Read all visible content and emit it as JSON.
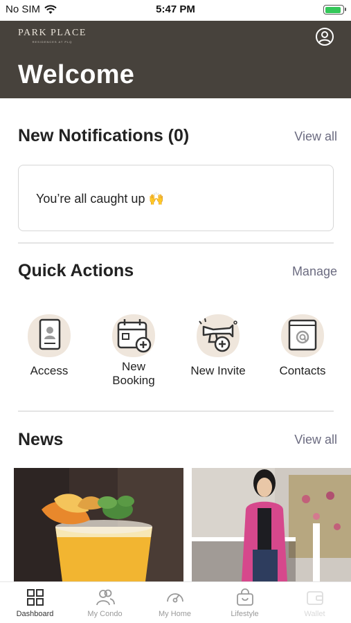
{
  "status_bar": {
    "carrier": "No SIM",
    "time": "5:47 PM"
  },
  "header": {
    "logo_main": "PARK PLACE",
    "logo_sub": "RESIDENCES AT PLQ",
    "title": "Welcome"
  },
  "notifications": {
    "title": "New Notifications (0)",
    "view_all": "View all",
    "empty_message": "You’re all caught up 🙌"
  },
  "quick_actions": {
    "title": "Quick Actions",
    "manage": "Manage",
    "items": [
      {
        "label": "Access",
        "icon": "id-badge-icon"
      },
      {
        "label": "New\nBooking",
        "icon": "calendar-plus-icon"
      },
      {
        "label": "New Invite",
        "icon": "trumpet-plus-icon"
      },
      {
        "label": "Contacts",
        "icon": "contact-book-icon"
      }
    ]
  },
  "news": {
    "title": "News",
    "view_all": "View all"
  },
  "tab_bar": {
    "items": [
      {
        "label": "Dashboard",
        "icon": "dashboard-grid-icon",
        "active": true
      },
      {
        "label": "My Condo",
        "icon": "people-icon"
      },
      {
        "label": "My Home",
        "icon": "speedometer-icon"
      },
      {
        "label": "Lifestyle",
        "icon": "shopping-basket-icon"
      },
      {
        "label": "Wallet",
        "icon": "wallet-icon"
      }
    ]
  },
  "colors": {
    "header_bg": "#47423c",
    "icon_blob": "#efe6dc",
    "link": "#6b6b80"
  }
}
